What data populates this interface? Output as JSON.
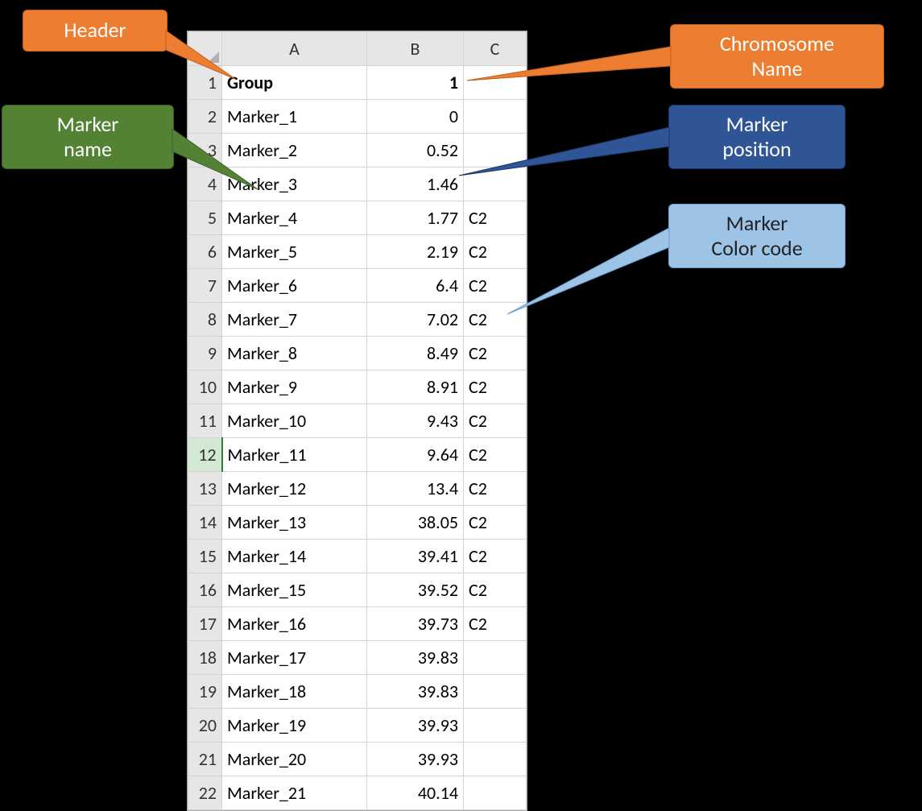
{
  "columns": {
    "a": "A",
    "b": "B",
    "c": "C"
  },
  "callouts": {
    "header": "Header",
    "chromosome_l1": "Chromosome",
    "chromosome_l2": "Name",
    "marker_name_l1": "Marker",
    "marker_name_l2": "name",
    "marker_pos_l1": "Marker",
    "marker_pos_l2": "position",
    "marker_color_l1": "Marker",
    "marker_color_l2": "Color code"
  },
  "header_row": {
    "label": "Group",
    "value": "1"
  },
  "rows": [
    {
      "n": "1",
      "a": "Group",
      "b": "1",
      "c": "",
      "bold": true
    },
    {
      "n": "2",
      "a": "Marker_1",
      "b": "0",
      "c": ""
    },
    {
      "n": "3",
      "a": "Marker_2",
      "b": "0.52",
      "c": ""
    },
    {
      "n": "4",
      "a": "Marker_3",
      "b": "1.46",
      "c": ""
    },
    {
      "n": "5",
      "a": "Marker_4",
      "b": "1.77",
      "c": "C2"
    },
    {
      "n": "6",
      "a": "Marker_5",
      "b": "2.19",
      "c": "C2"
    },
    {
      "n": "7",
      "a": "Marker_6",
      "b": "6.4",
      "c": "C2"
    },
    {
      "n": "8",
      "a": "Marker_7",
      "b": "7.02",
      "c": "C2"
    },
    {
      "n": "9",
      "a": "Marker_8",
      "b": "8.49",
      "c": "C2"
    },
    {
      "n": "10",
      "a": "Marker_9",
      "b": "8.91",
      "c": "C2"
    },
    {
      "n": "11",
      "a": "Marker_10",
      "b": "9.43",
      "c": "C2"
    },
    {
      "n": "12",
      "a": "Marker_11",
      "b": "9.64",
      "c": "C2",
      "selected": true
    },
    {
      "n": "13",
      "a": "Marker_12",
      "b": "13.4",
      "c": "C2"
    },
    {
      "n": "14",
      "a": "Marker_13",
      "b": "38.05",
      "c": "C2"
    },
    {
      "n": "15",
      "a": "Marker_14",
      "b": "39.41",
      "c": "C2"
    },
    {
      "n": "16",
      "a": "Marker_15",
      "b": "39.52",
      "c": "C2"
    },
    {
      "n": "17",
      "a": "Marker_16",
      "b": "39.73",
      "c": "C2"
    },
    {
      "n": "18",
      "a": "Marker_17",
      "b": "39.83",
      "c": ""
    },
    {
      "n": "19",
      "a": "Marker_18",
      "b": "39.83",
      "c": ""
    },
    {
      "n": "20",
      "a": "Marker_19",
      "b": "39.93",
      "c": ""
    },
    {
      "n": "21",
      "a": "Marker_20",
      "b": "39.93",
      "c": ""
    },
    {
      "n": "22",
      "a": "Marker_21",
      "b": "40.14",
      "c": ""
    }
  ]
}
